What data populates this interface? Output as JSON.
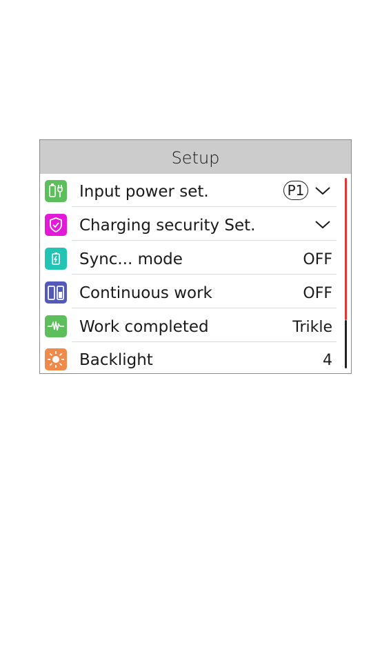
{
  "screen": {
    "title": "Setup"
  },
  "menu": {
    "items": [
      {
        "label": "Input power set.",
        "badge": "P1",
        "value": "",
        "has_dropdown": true,
        "icon": "power-plug-icon",
        "icon_color": "#5cbf5c"
      },
      {
        "label": "Charging security Set.",
        "badge": "",
        "value": "",
        "has_dropdown": true,
        "icon": "shield-check-icon",
        "icon_color": "#e21ad8"
      },
      {
        "label": "Sync... mode",
        "badge": "",
        "value": "OFF",
        "has_dropdown": false,
        "icon": "sync-battery-icon",
        "icon_color": "#22c5b3"
      },
      {
        "label": "Continuous work",
        "badge": "",
        "value": "OFF",
        "has_dropdown": false,
        "icon": "dual-battery-icon",
        "icon_color": "#5259b8"
      },
      {
        "label": "Work completed",
        "badge": "",
        "value": "Trikle",
        "has_dropdown": false,
        "icon": "waveform-icon",
        "icon_color": "#5cbf5c"
      },
      {
        "label": "Backlight",
        "badge": "",
        "value": "4",
        "has_dropdown": false,
        "icon": "sun-icon",
        "icon_color": "#f08a4b"
      }
    ]
  },
  "colors": {
    "header_bg": "#cccccc",
    "scrollbar_active": "#e03535",
    "scrollbar_rest": "#222222"
  }
}
